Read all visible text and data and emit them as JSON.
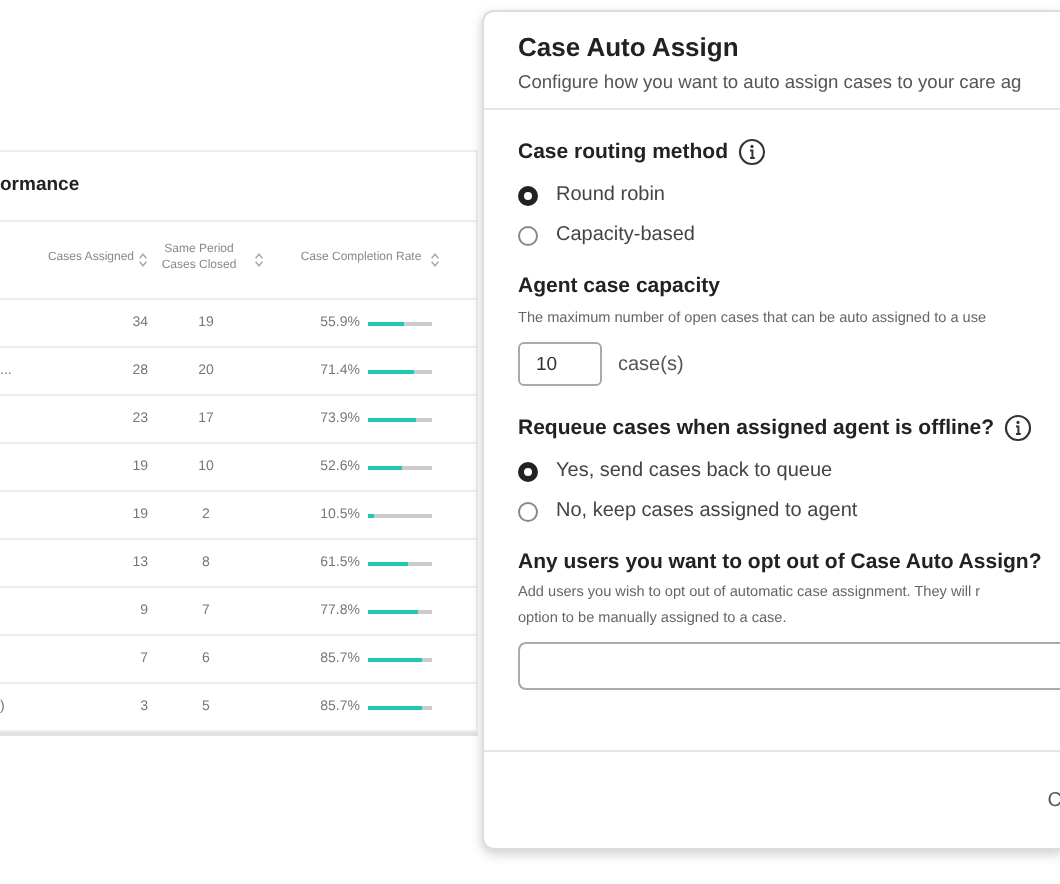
{
  "table": {
    "title": "ormance",
    "columns": [
      {
        "label": "Cases Assigned"
      },
      {
        "label": "Same Period Cases Closed"
      },
      {
        "label": "Case Completion Rate"
      }
    ],
    "rows": [
      {
        "name": "",
        "assigned": "34",
        "closed": "19",
        "rate": "55.9%",
        "level": 0.559
      },
      {
        "name": "...",
        "assigned": "28",
        "closed": "20",
        "rate": "71.4%",
        "level": 0.714
      },
      {
        "name": "",
        "assigned": "23",
        "closed": "17",
        "rate": "73.9%",
        "level": 0.739
      },
      {
        "name": "",
        "assigned": "19",
        "closed": "10",
        "rate": "52.6%",
        "level": 0.526
      },
      {
        "name": "",
        "assigned": "19",
        "closed": "2",
        "rate": "10.5%",
        "level": 0.105
      },
      {
        "name": "",
        "assigned": "13",
        "closed": "8",
        "rate": "61.5%",
        "level": 0.615
      },
      {
        "name": "",
        "assigned": "9",
        "closed": "7",
        "rate": "77.8%",
        "level": 0.778
      },
      {
        "name": "",
        "assigned": "7",
        "closed": "6",
        "rate": "85.7%",
        "level": 0.857
      },
      {
        "name": ")",
        "assigned": "3",
        "closed": "5",
        "rate": "85.7%",
        "level": 0.857
      }
    ]
  },
  "dialog": {
    "title": "Case Auto Assign",
    "subtitle": "Configure how you want to auto assign cases to your care ag",
    "routing": {
      "label": "Case routing method",
      "options": [
        {
          "label": "Round robin",
          "selected": true
        },
        {
          "label": "Capacity-based",
          "selected": false
        }
      ]
    },
    "capacity": {
      "label": "Agent case capacity",
      "help": "The maximum number of open cases that can be auto assigned to a use",
      "value": "10",
      "unit": "case(s)"
    },
    "requeue": {
      "label": "Requeue cases when assigned agent is offline?",
      "options": [
        {
          "label": "Yes, send cases back to queue",
          "selected": true
        },
        {
          "label": "No, keep cases assigned to agent",
          "selected": false
        }
      ]
    },
    "optout": {
      "label": "Any users you want to opt out of Case Auto Assign?",
      "help": [
        "Add users you wish to opt out of automatic case assignment. They will r",
        "option to be manually assigned to a case."
      ]
    },
    "footer_button": "C"
  }
}
